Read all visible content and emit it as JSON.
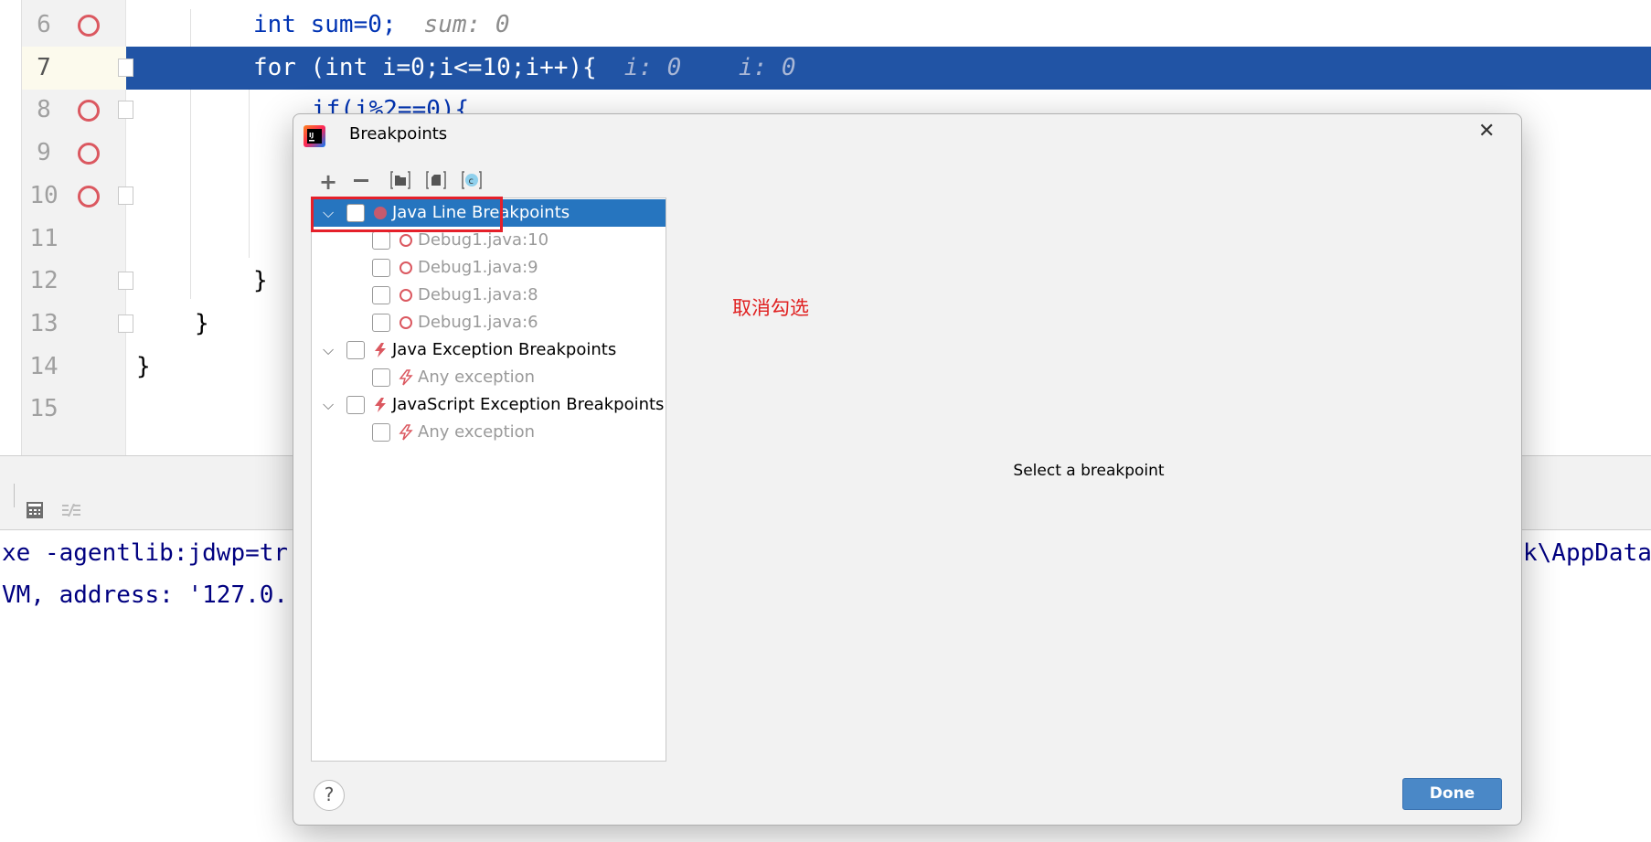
{
  "editor": {
    "lines": [
      {
        "num": "6",
        "breakpoint": true,
        "code": "int sum=0;",
        "hint": "sum: 0"
      },
      {
        "num": "7",
        "breakpoint": false,
        "current": true,
        "code": "for (int i=0;i<=10;i++){",
        "hint": "i: 0    i: 0"
      },
      {
        "num": "8",
        "breakpoint": true,
        "code": "if(i%2==0){"
      },
      {
        "num": "9",
        "breakpoint": true,
        "code": ""
      },
      {
        "num": "10",
        "breakpoint": true,
        "code": ""
      },
      {
        "num": "11",
        "breakpoint": false,
        "code": ""
      },
      {
        "num": "12",
        "breakpoint": false,
        "code": "}"
      },
      {
        "num": "13",
        "breakpoint": false,
        "code": "}"
      },
      {
        "num": "14",
        "breakpoint": false,
        "code": "}"
      },
      {
        "num": "15",
        "breakpoint": false,
        "code": ""
      }
    ]
  },
  "console": {
    "line1_left": "xe -agentlib:jdwp=tr",
    "line1_right": "k\\AppData",
    "line2_left": "VM, address: '127.0."
  },
  "dialog": {
    "title": "Breakpoints",
    "toolbar": [
      "add-icon",
      "remove-icon",
      "group-by-package-icon",
      "group-by-file-icon",
      "group-by-class-icon"
    ],
    "tree": [
      {
        "label": "Java Line Breakpoints",
        "level": 0,
        "icon": "breakpoint-dot-icon",
        "selected": true,
        "checked": false
      },
      {
        "label": "Debug1.java:10",
        "level": 1,
        "icon": "breakpoint-circle-icon",
        "checked": false
      },
      {
        "label": "Debug1.java:9",
        "level": 1,
        "icon": "breakpoint-circle-icon",
        "checked": false
      },
      {
        "label": "Debug1.java:8",
        "level": 1,
        "icon": "breakpoint-circle-icon",
        "checked": false
      },
      {
        "label": "Debug1.java:6",
        "level": 1,
        "icon": "breakpoint-circle-icon",
        "checked": false
      },
      {
        "label": "Java Exception Breakpoints",
        "level": 0,
        "icon": "lightning-icon",
        "checked": false
      },
      {
        "label": "Any exception",
        "level": 1,
        "icon": "lightning-outline-icon",
        "checked": false
      },
      {
        "label": "JavaScript Exception Breakpoints",
        "level": 0,
        "icon": "lightning-icon",
        "checked": false
      },
      {
        "label": "Any exception",
        "level": 1,
        "icon": "lightning-outline-icon",
        "checked": false
      }
    ],
    "detail_placeholder": "Select a breakpoint",
    "done_label": "Done",
    "help_label": "?",
    "close_label": "✕"
  },
  "annotation": {
    "text": "取消勾选",
    "color": "#e02020"
  },
  "colors": {
    "accent": "#2675bf",
    "current_line": "#2154a5",
    "breakpoint": "#db5860",
    "done": "#4a88c7"
  }
}
